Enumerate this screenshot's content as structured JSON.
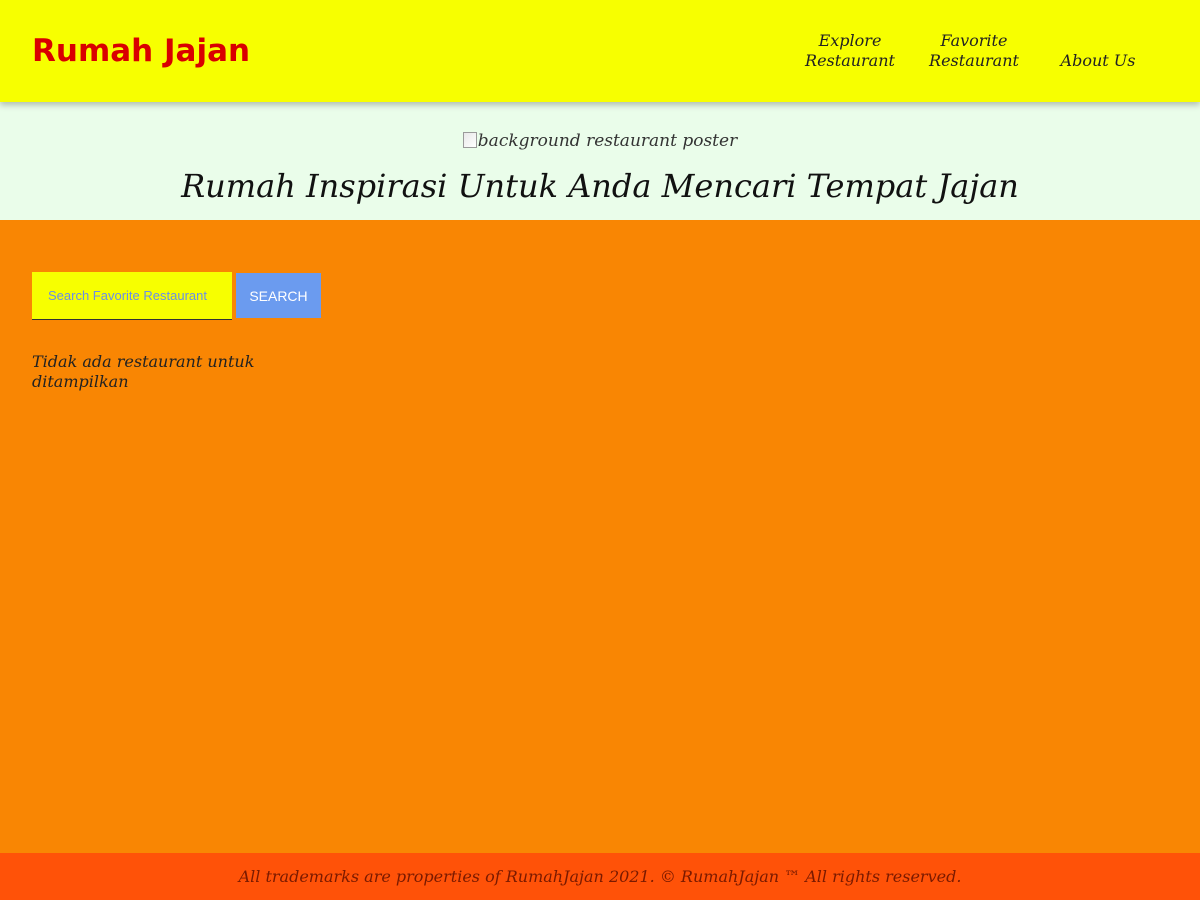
{
  "header": {
    "brand": "Rumah Jajan",
    "nav": [
      {
        "line1": "Explore",
        "line2": "Restaurant"
      },
      {
        "line1": "Favorite",
        "line2": "Restaurant"
      },
      {
        "line1": "",
        "line2": "About Us"
      }
    ]
  },
  "hero": {
    "poster_alt": "background restaurant poster",
    "title": "Rumah Inspirasi Untuk Anda Mencari Tempat Jajan"
  },
  "search": {
    "placeholder": "Search Favorite Restaurant",
    "value": "",
    "button_label": "SEARCH"
  },
  "main": {
    "empty_message": "Tidak ada restaurant untuk ditampilkan"
  },
  "footer": {
    "text": "All trademarks are properties of RumahJajan 2021. © RumahJajan ™ All rights reserved."
  },
  "colors": {
    "header_bg": "#F7FF00",
    "brand": "#D90000",
    "hero_bg": "#EAFDEA",
    "main_bg": "#F98603",
    "search_button": "#6B9BEF",
    "footer_bg": "#FF5208"
  }
}
